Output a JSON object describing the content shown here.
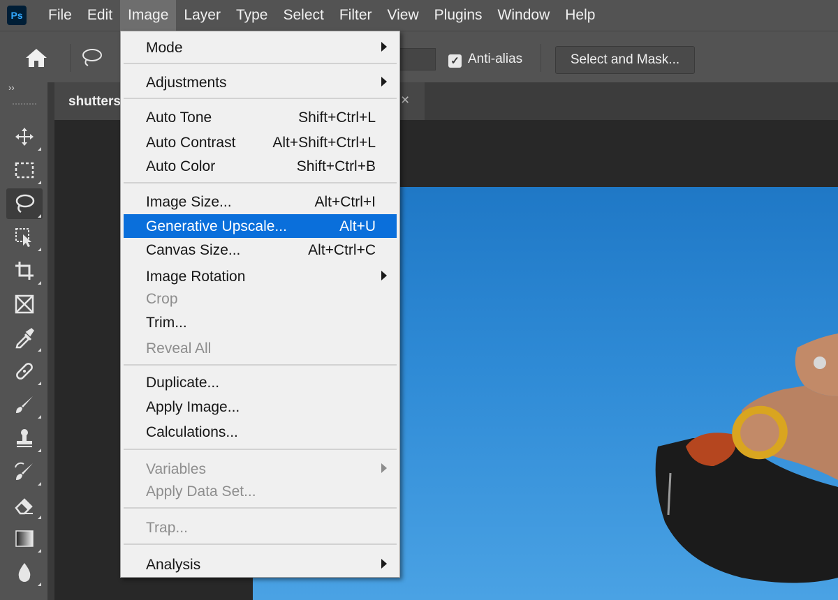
{
  "app_logo": "Ps",
  "menubar": {
    "items": [
      "File",
      "Edit",
      "Image",
      "Layer",
      "Type",
      "Select",
      "Filter",
      "View",
      "Plugins",
      "Window",
      "Help"
    ],
    "active": "Image"
  },
  "options_bar": {
    "anti_alias_label": "Anti-alias",
    "anti_alias_checked": true,
    "select_and_mask_label": "Select and Mask..."
  },
  "toolbar": {
    "collapse_glyph": "››",
    "tools": [
      "move-tool",
      "rectangular-marquee-tool",
      "lasso-tool",
      "object-selection-tool",
      "crop-tool",
      "frame-tool",
      "eyedropper-tool",
      "spot-healing-brush-tool",
      "brush-tool",
      "clone-stamp-tool",
      "history-brush-tool",
      "eraser-tool",
      "gradient-tool",
      "blur-tool"
    ],
    "active_tool": "lasso-tool"
  },
  "document": {
    "tab_name": "shutters",
    "close_glyph": "×"
  },
  "image_menu": {
    "mode": "Mode",
    "adjustments": "Adjustments",
    "auto_tone": {
      "label": "Auto Tone",
      "shortcut": "Shift+Ctrl+L"
    },
    "auto_contrast": {
      "label": "Auto Contrast",
      "shortcut": "Alt+Shift+Ctrl+L"
    },
    "auto_color": {
      "label": "Auto Color",
      "shortcut": "Shift+Ctrl+B"
    },
    "image_size": {
      "label": "Image Size...",
      "shortcut": "Alt+Ctrl+I"
    },
    "generative_upscale": {
      "label": "Generative Upscale...",
      "shortcut": "Alt+U"
    },
    "canvas_size": {
      "label": "Canvas Size...",
      "shortcut": "Alt+Ctrl+C"
    },
    "image_rotation": "Image Rotation",
    "crop": "Crop",
    "trim": "Trim...",
    "reveal_all": "Reveal All",
    "duplicate": "Duplicate...",
    "apply_image": "Apply Image...",
    "calculations": "Calculations...",
    "variables": "Variables",
    "apply_data_set": "Apply Data Set...",
    "trap": "Trap...",
    "analysis": "Analysis"
  },
  "colors": {
    "highlight": "#0a6fdb",
    "menu_bg": "#f0f0f0",
    "chrome": "#535353",
    "sky": "#2f8bd6"
  }
}
